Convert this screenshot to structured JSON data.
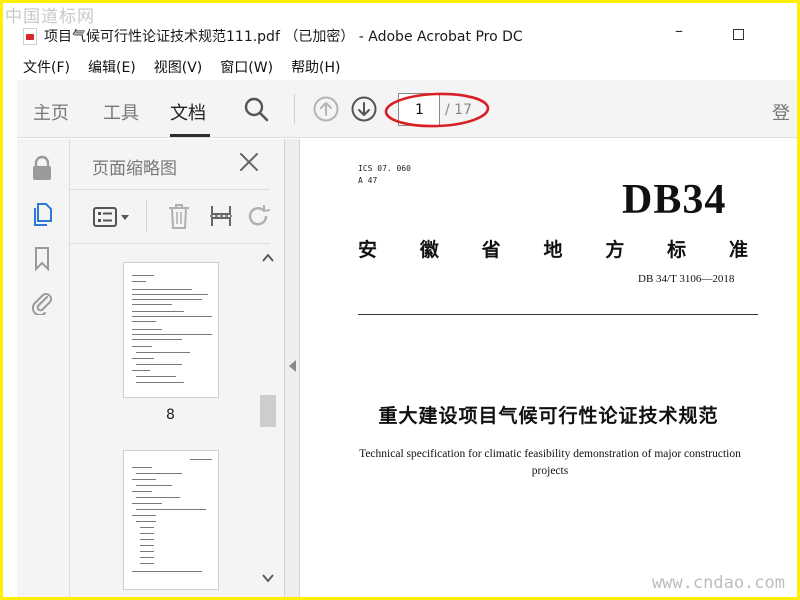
{
  "watermark": {
    "top": "中国道标网",
    "bottom": "www.cndao.com"
  },
  "window": {
    "title": "项目气候可行性论证技术规范111.pdf （已加密） - Adobe Acrobat Pro DC"
  },
  "menubar": {
    "items": [
      "文件(F)",
      "编辑(E)",
      "视图(V)",
      "窗口(W)",
      "帮助(H)"
    ]
  },
  "toolbar": {
    "tabs": {
      "home": "主页",
      "tools": "工具",
      "document": "文档"
    },
    "page_current": "1",
    "page_total": "/ 17",
    "login": "登"
  },
  "thumb_panel": {
    "title": "页面缩略图",
    "pages": [
      {
        "label": "8"
      },
      {
        "label": ""
      }
    ]
  },
  "document": {
    "ics": "ICS 07. 060",
    "category": "A 47",
    "code": "DB34",
    "std_type_chars": [
      "安",
      "徽",
      "省",
      "地",
      "方",
      "标",
      "准"
    ],
    "std_number": "DB 34/T  3106—2018",
    "title": "重大建设项目气候可行性论证技术规范",
    "subtitle_en": "Technical specification for climatic feasibility demonstration of major construction projects"
  },
  "colors": {
    "frame": "#ffef00",
    "toolbar_bg": "#f4f4f4",
    "rail_active_icon": "#2d7ad6",
    "annotation_red": "#d91f26"
  }
}
